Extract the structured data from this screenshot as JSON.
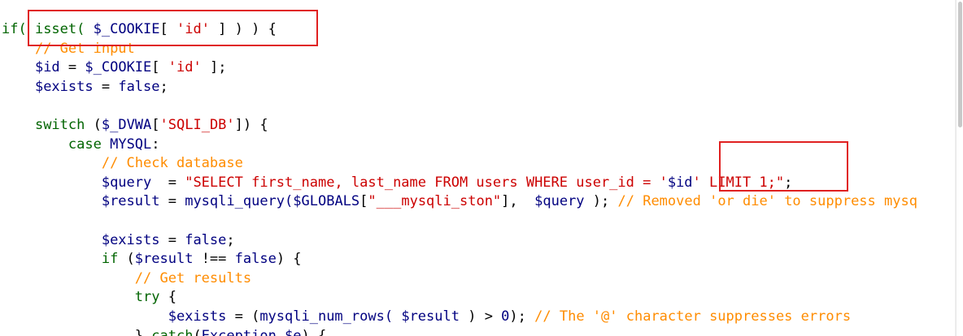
{
  "code": {
    "lines": [
      {
        "indent": 0,
        "tokens": [
          {
            "t": "if( ",
            "c": "kw"
          },
          {
            "t": "isset( ",
            "c": "kw"
          },
          {
            "t": "$_COOKIE",
            "c": "var"
          },
          {
            "t": "[ ",
            "c": "default"
          },
          {
            "t": "'id'",
            "c": "str"
          },
          {
            "t": " ] ) ) {",
            "c": "default"
          }
        ]
      },
      {
        "indent": 4,
        "tokens": [
          {
            "t": "// Get input",
            "c": "comment"
          }
        ]
      },
      {
        "indent": 4,
        "tokens": [
          {
            "t": "$id",
            "c": "var"
          },
          {
            "t": " = ",
            "c": "default"
          },
          {
            "t": "$_COOKIE",
            "c": "var"
          },
          {
            "t": "[ ",
            "c": "default"
          },
          {
            "t": "'id'",
            "c": "str"
          },
          {
            "t": " ];",
            "c": "default"
          }
        ]
      },
      {
        "indent": 4,
        "tokens": [
          {
            "t": "$exists",
            "c": "var"
          },
          {
            "t": " = ",
            "c": "default"
          },
          {
            "t": "false",
            "c": "const"
          },
          {
            "t": ";",
            "c": "default"
          }
        ]
      },
      {
        "indent": 0,
        "tokens": []
      },
      {
        "indent": 4,
        "tokens": [
          {
            "t": "switch",
            "c": "kw"
          },
          {
            "t": " (",
            "c": "default"
          },
          {
            "t": "$_DVWA",
            "c": "var"
          },
          {
            "t": "[",
            "c": "default"
          },
          {
            "t": "'SQLI_DB'",
            "c": "str"
          },
          {
            "t": "]) {",
            "c": "default"
          }
        ]
      },
      {
        "indent": 8,
        "tokens": [
          {
            "t": "case",
            "c": "kw"
          },
          {
            "t": " ",
            "c": "default"
          },
          {
            "t": "MYSQL",
            "c": "const"
          },
          {
            "t": ":",
            "c": "default"
          }
        ]
      },
      {
        "indent": 12,
        "tokens": [
          {
            "t": "// Check database",
            "c": "comment"
          }
        ]
      },
      {
        "indent": 12,
        "tokens": [
          {
            "t": "$query",
            "c": "var"
          },
          {
            "t": "  = ",
            "c": "default"
          },
          {
            "t": "\"SELECT first_name, last_name FROM users WHERE user_id = '",
            "c": "str"
          },
          {
            "t": "$id",
            "c": "var"
          },
          {
            "t": "' LIMIT 1;\"",
            "c": "str"
          },
          {
            "t": ";",
            "c": "default"
          }
        ]
      },
      {
        "indent": 12,
        "tokens": [
          {
            "t": "$result",
            "c": "var"
          },
          {
            "t": " = ",
            "c": "default"
          },
          {
            "t": "mysqli_query(",
            "c": "var"
          },
          {
            "t": "$GLOBALS",
            "c": "var"
          },
          {
            "t": "[",
            "c": "default"
          },
          {
            "t": "\"___mysqli_ston\"",
            "c": "str"
          },
          {
            "t": "],  ",
            "c": "default"
          },
          {
            "t": "$query",
            "c": "var"
          },
          {
            "t": " ); ",
            "c": "default"
          },
          {
            "t": "// Removed 'or die' to suppress mysq",
            "c": "comment"
          }
        ]
      },
      {
        "indent": 0,
        "tokens": []
      },
      {
        "indent": 12,
        "tokens": [
          {
            "t": "$exists",
            "c": "var"
          },
          {
            "t": " = ",
            "c": "default"
          },
          {
            "t": "false",
            "c": "const"
          },
          {
            "t": ";",
            "c": "default"
          }
        ]
      },
      {
        "indent": 12,
        "tokens": [
          {
            "t": "if",
            "c": "kw"
          },
          {
            "t": " (",
            "c": "default"
          },
          {
            "t": "$result",
            "c": "var"
          },
          {
            "t": " !== ",
            "c": "default"
          },
          {
            "t": "false",
            "c": "const"
          },
          {
            "t": ") {",
            "c": "default"
          }
        ]
      },
      {
        "indent": 16,
        "tokens": [
          {
            "t": "// Get results",
            "c": "comment"
          }
        ]
      },
      {
        "indent": 16,
        "tokens": [
          {
            "t": "try",
            "c": "kw"
          },
          {
            "t": " {",
            "c": "default"
          }
        ]
      },
      {
        "indent": 20,
        "tokens": [
          {
            "t": "$exists",
            "c": "var"
          },
          {
            "t": " = (",
            "c": "default"
          },
          {
            "t": "mysqli_num_rows(",
            "c": "var"
          },
          {
            "t": " ",
            "c": "default"
          },
          {
            "t": "$result",
            "c": "var"
          },
          {
            "t": " ) > ",
            "c": "default"
          },
          {
            "t": "0",
            "c": "const"
          },
          {
            "t": "); ",
            "c": "default"
          },
          {
            "t": "// The '@' character suppresses errors",
            "c": "comment"
          }
        ]
      },
      {
        "indent": 16,
        "tokens": [
          {
            "t": "} ",
            "c": "default"
          },
          {
            "t": "catch",
            "c": "kw"
          },
          {
            "t": "(",
            "c": "default"
          },
          {
            "t": "Exception",
            "c": "const"
          },
          {
            "t": " ",
            "c": "default"
          },
          {
            "t": "$e",
            "c": "var"
          },
          {
            "t": ") {",
            "c": "default"
          }
        ]
      }
    ]
  },
  "colors": {
    "default": "#000000",
    "var": "#000080",
    "str": "#cc0000",
    "comment": "#ff8c00",
    "kw": "#006400",
    "const": "#000080",
    "highlight": "#e02020"
  }
}
